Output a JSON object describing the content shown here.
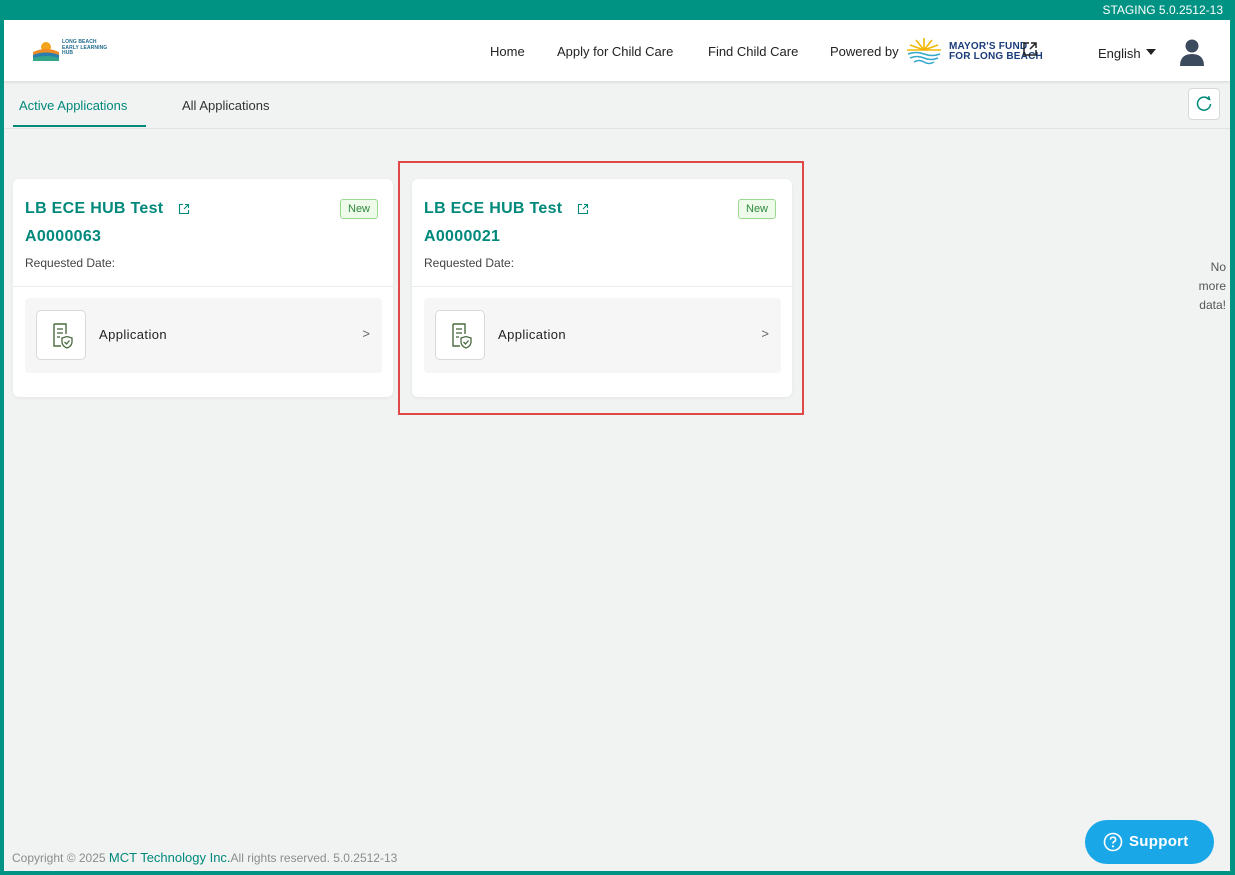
{
  "env_badge": "STAGING 5.0.2512-13",
  "header": {
    "logo_lines": [
      "LONG BEACH",
      "EARLY LEARNING",
      "HUB"
    ],
    "nav": [
      "Home",
      "Apply for Child Care",
      "Find Child Care"
    ],
    "powered_by": "Powered by",
    "partner_line1": "MAYOR'S FUND",
    "partner_line2": "FOR LONG BEACH",
    "language": "English"
  },
  "tabs": [
    {
      "label": "Active Applications",
      "active": true
    },
    {
      "label": "All Applications",
      "active": false
    }
  ],
  "cards": [
    {
      "title": "LB ECE HUB Test",
      "badge": "New",
      "application_id": "A0000063",
      "requested_date_label": "Requested Date:",
      "item_label": "Application",
      "chevron": ">"
    },
    {
      "title": "LB ECE HUB Test",
      "badge": "New",
      "application_id": "A0000021",
      "requested_date_label": "Requested Date:",
      "item_label": "Application",
      "chevron": ">"
    }
  ],
  "no_more_data": [
    "No",
    "more",
    "data!"
  ],
  "footer": {
    "prefix": "Copyright © 2025 ",
    "brand": "MCT Technology Inc.",
    "suffix": "All rights reserved. 5.0.2512-13"
  },
  "support_label": "Support",
  "colors": {
    "brand_teal": "#00897b",
    "frame": "#009383",
    "support_blue": "#1aa7e8",
    "highlight_red": "#e04848",
    "badge_green": "#2e8b3e"
  },
  "icons": [
    "external-link-icon",
    "caret-down-icon",
    "user-avatar-icon",
    "refresh-icon",
    "application-doc-icon",
    "chevron-right-icon",
    "help-circle-icon"
  ]
}
